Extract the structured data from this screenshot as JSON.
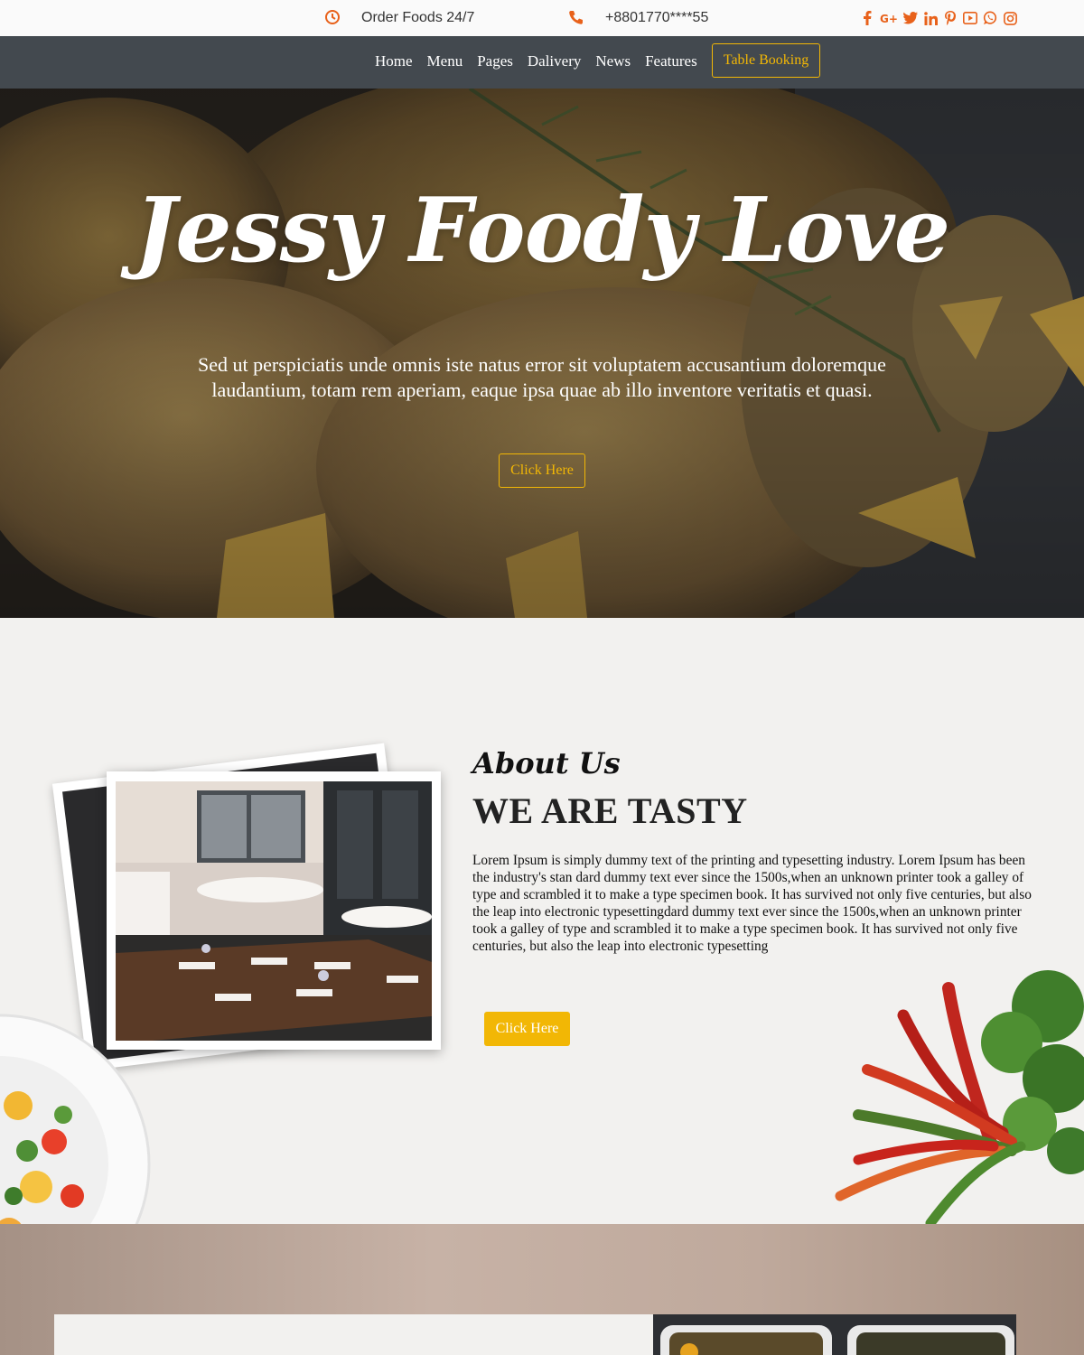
{
  "topbar": {
    "order_text": "Order Foods 24/7",
    "phone_text": "+8801770****55",
    "clock_icon": "clock-icon",
    "phone_icon": "phone-icon",
    "socials": [
      "facebook-icon",
      "google-plus-icon",
      "twitter-icon",
      "linkedin-icon",
      "pinterest-icon",
      "youtube-icon",
      "whatsapp-icon",
      "instagram-icon"
    ],
    "accent_color": "#e8611a"
  },
  "nav": {
    "items": [
      "Home",
      "Menu",
      "Pages",
      "Dalivery",
      "News",
      "Features"
    ],
    "booking_label": "Table Booking",
    "background": "#43494f",
    "highlight_color": "#f2b705"
  },
  "hero": {
    "title": "Jessy Foody Love",
    "subtitle": "Sed ut perspiciatis unde omnis iste natus error sit voluptatem accusantium doloremque laudantium, totam rem aperiam, eaque ipsa quae ab illo inventore veritatis et quasi.",
    "button_label": "Click Here"
  },
  "about": {
    "kicker": "About Us",
    "title": "WE ARE TASTY",
    "body": "Lorem Ipsum is simply dummy text of the printing and typesetting industry. Lorem Ipsum has been the industry's stan dard dummy text ever since the 1500s,when an unknown printer took a galley of type and scrambled it to make a type specimen book. It has survived not only five centuries, but also the leap into electronic typesettingdard dummy text ever since the 1500s,when an unknown printer took a galley of type and scrambled it to make a type specimen book. It has survived not only five centuries, but also the leap into electronic typesetting",
    "button_label": "Click Here",
    "button_color": "#f2b705"
  }
}
